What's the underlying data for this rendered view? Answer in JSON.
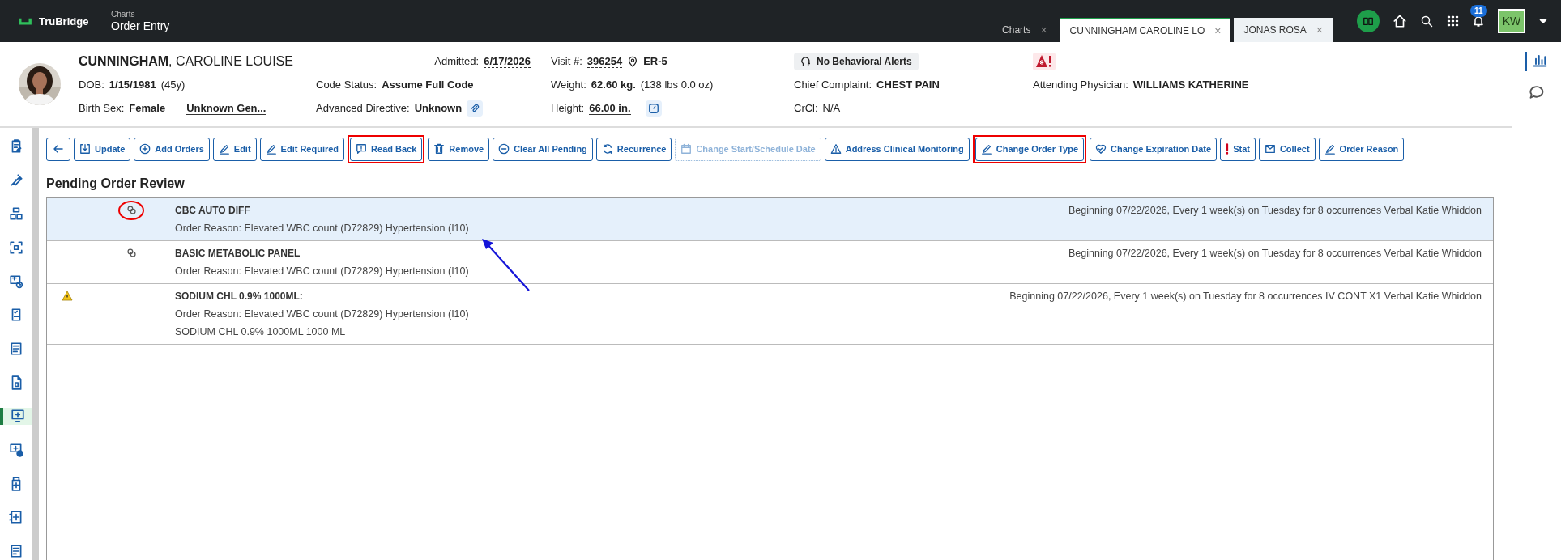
{
  "topbar": {
    "brand": "TruBridge",
    "section": "Charts",
    "page": "Order Entry",
    "tabs": [
      {
        "label": "Charts",
        "close": "×",
        "selected": false
      },
      {
        "label": "CUNNINGHAM CAROLINE LO",
        "close": "×",
        "selected": true
      },
      {
        "label": "JONAS ROSA",
        "close": "×",
        "selected": false
      }
    ],
    "notification_count": "11",
    "user_initials": "KW"
  },
  "patient": {
    "name": "**CUNNINGHAM**, CAROLINE LOUISE",
    "admitted": {
      "label": "Admitted:",
      "value": "6/17/2026"
    },
    "visit": {
      "label": "Visit #:",
      "value": "396254",
      "location": "ER-5"
    },
    "behavioral_alerts": "No Behavioral Alerts",
    "dob": {
      "label": "DOB:",
      "value": "1/15/1981",
      "age": "(45y)"
    },
    "code_status": {
      "label": "Code Status:",
      "value": "Assume Full Code"
    },
    "weight": {
      "label": "Weight:",
      "value": "62.60 kg.",
      "extra": "(138 lbs 0.0 oz)"
    },
    "chief_complaint": {
      "label": "Chief Complaint:",
      "value": "CHEST PAIN"
    },
    "attending": {
      "label": "Attending Physician:",
      "value": "WILLIAMS KATHERINE"
    },
    "birth_sex": {
      "label": "Birth Sex:",
      "value": "Female",
      "gender": "Unknown Gen..."
    },
    "advanced_directive": {
      "label": "Advanced Directive:",
      "value": "Unknown"
    },
    "height": {
      "label": "Height:",
      "value": "66.00 in."
    },
    "crcl": {
      "label": "CrCl:",
      "value": "N/A"
    }
  },
  "sidebar": {
    "items": [
      {
        "selected": false
      },
      {
        "selected": false
      },
      {
        "selected": false
      },
      {
        "selected": false
      },
      {
        "selected": false
      },
      {
        "selected": false
      },
      {
        "selected": false
      },
      {
        "selected": false
      },
      {
        "selected": true
      },
      {
        "selected": false
      },
      {
        "selected": false
      },
      {
        "selected": false
      },
      {
        "selected": false
      }
    ]
  },
  "toolbar": [
    {
      "kind": "back",
      "disabled": false,
      "highlighted": false
    },
    {
      "kind": "button",
      "label": "Update",
      "disabled": false,
      "highlighted": false
    },
    {
      "kind": "button",
      "label": "Add Orders",
      "disabled": false,
      "highlighted": false
    },
    {
      "kind": "button",
      "label": "Edit",
      "disabled": false,
      "highlighted": false
    },
    {
      "kind": "button",
      "label": "Edit Required",
      "disabled": false,
      "highlighted": false
    },
    {
      "kind": "button",
      "label": "Read Back",
      "disabled": false,
      "highlighted": true
    },
    {
      "kind": "button",
      "label": "Remove",
      "disabled": false,
      "highlighted": false
    },
    {
      "kind": "button",
      "label": "Clear All Pending",
      "disabled": false,
      "highlighted": false
    },
    {
      "kind": "button",
      "label": "Recurrence",
      "disabled": false,
      "highlighted": false
    },
    {
      "kind": "button",
      "label": "Change Start/Schedule Date",
      "disabled": true,
      "highlighted": false
    },
    {
      "kind": "button",
      "label": "Address Clinical Monitoring",
      "disabled": false,
      "highlighted": false
    },
    {
      "kind": "button",
      "label": "Change Order Type",
      "disabled": false,
      "highlighted": true
    },
    {
      "kind": "button",
      "label": "Change Expiration Date",
      "disabled": false,
      "highlighted": false
    },
    {
      "kind": "button",
      "label": "Stat",
      "disabled": false,
      "highlighted": false
    },
    {
      "kind": "button",
      "label": "Collect",
      "disabled": false,
      "highlighted": false
    },
    {
      "kind": "button",
      "label": "Order Reason",
      "disabled": false,
      "highlighted": false
    }
  ],
  "section_title": "Pending Order Review",
  "orders": [
    {
      "kind": "linked",
      "circled": true,
      "selected": true,
      "title": "CBC AUTO DIFF",
      "schedule": "Beginning 07/22/2026, Every 1 week(s) on Tuesday for 8 occurrences Verbal Katie Whiddon",
      "lines": [
        "Order Reason: Elevated WBC count (D72829) Hypertension (I10)"
      ]
    },
    {
      "kind": "linked",
      "circled": false,
      "selected": false,
      "title": "BASIC METABOLIC PANEL",
      "schedule": "Beginning 07/22/2026, Every 1 week(s) on Tuesday for 8 occurrences Verbal Katie Whiddon",
      "lines": [
        "Order Reason: Elevated WBC count (D72829) Hypertension (I10)"
      ]
    },
    {
      "kind": "warning",
      "circled": false,
      "selected": false,
      "title": "SODIUM CHL 0.9% 1000ML:",
      "schedule": "Beginning 07/22/2026, Every 1 week(s) on Tuesday for 8 occurrences IV CONT X1 Verbal Katie Whiddon",
      "lines": [
        "Order Reason: Elevated WBC count (D72829) Hypertension (I10)",
        "SODIUM CHL 0.9% 1000ML 1000 ML"
      ]
    }
  ]
}
